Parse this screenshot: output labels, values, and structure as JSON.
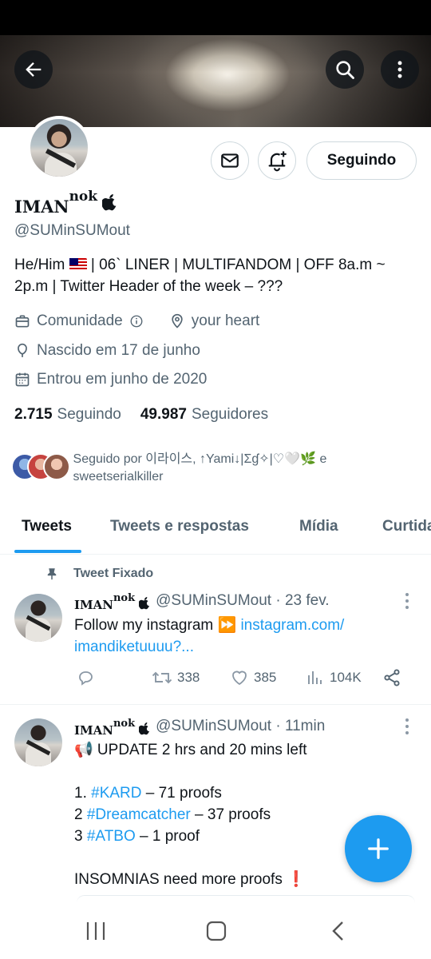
{
  "profile": {
    "name": "IMAN",
    "name_sup": "nok",
    "handle": "@SUMinSUMout",
    "bio_before_flag": "He/Him ",
    "bio_after_flag": " | 06` LINER | MULTIFANDOM | OFF 8a.m ~ 2p.m | Twitter Header of the week – ???",
    "category": "Comunidade",
    "location": "your heart",
    "birthday": "Nascido em 17 de junho",
    "joined": "Entrou em junho de 2020",
    "following_count": "2.715",
    "following_label": "Seguindo",
    "followers_count": "49.987",
    "followers_label": "Seguidores",
    "followed_by": "Seguido por 이라이스, ↑Yami↓|Σɠ✧|♡🤍🌿 e sweetserialkiller"
  },
  "buttons": {
    "follow_label": "Seguindo"
  },
  "tabs": [
    {
      "label": "Tweets"
    },
    {
      "label": "Tweets e respostas"
    },
    {
      "label": "Mídia"
    },
    {
      "label": "Curtidas"
    }
  ],
  "pinned_label": "Tweet Fixado",
  "tweets": [
    {
      "name": "IMAN",
      "name_sup": "nok",
      "handle_time": "@SUMinSUMout · 23 fev.",
      "text_before": "Follow my instagram ⏩ ",
      "link": "instagram.com/ imandiketuuuu?...",
      "replies": "",
      "retweets": "338",
      "likes": "385",
      "views": "104K"
    },
    {
      "name": "IMAN",
      "name_sup": "nok",
      "handle_time": "@SUMinSUMout · 11min",
      "line1": "📢 UPDATE 2 hrs and 20 mins left",
      "item1_prefix": "1. ",
      "item1_tag": "#KARD",
      "item1_suffix": " – 71 proofs",
      "item2_prefix": "2 ",
      "item2_tag": "#Dreamcatcher",
      "item2_suffix": " – 37 proofs",
      "item3_prefix": "3 ",
      "item3_tag": "#ATBO",
      "item3_suffix": " – 1 proof",
      "last_line": "INSOMNIAS need more proofs ❗"
    }
  ],
  "colors": {
    "accent": "#1d9bf0",
    "text": "#0f1419",
    "muted": "#536471",
    "border": "#cfd9de"
  }
}
